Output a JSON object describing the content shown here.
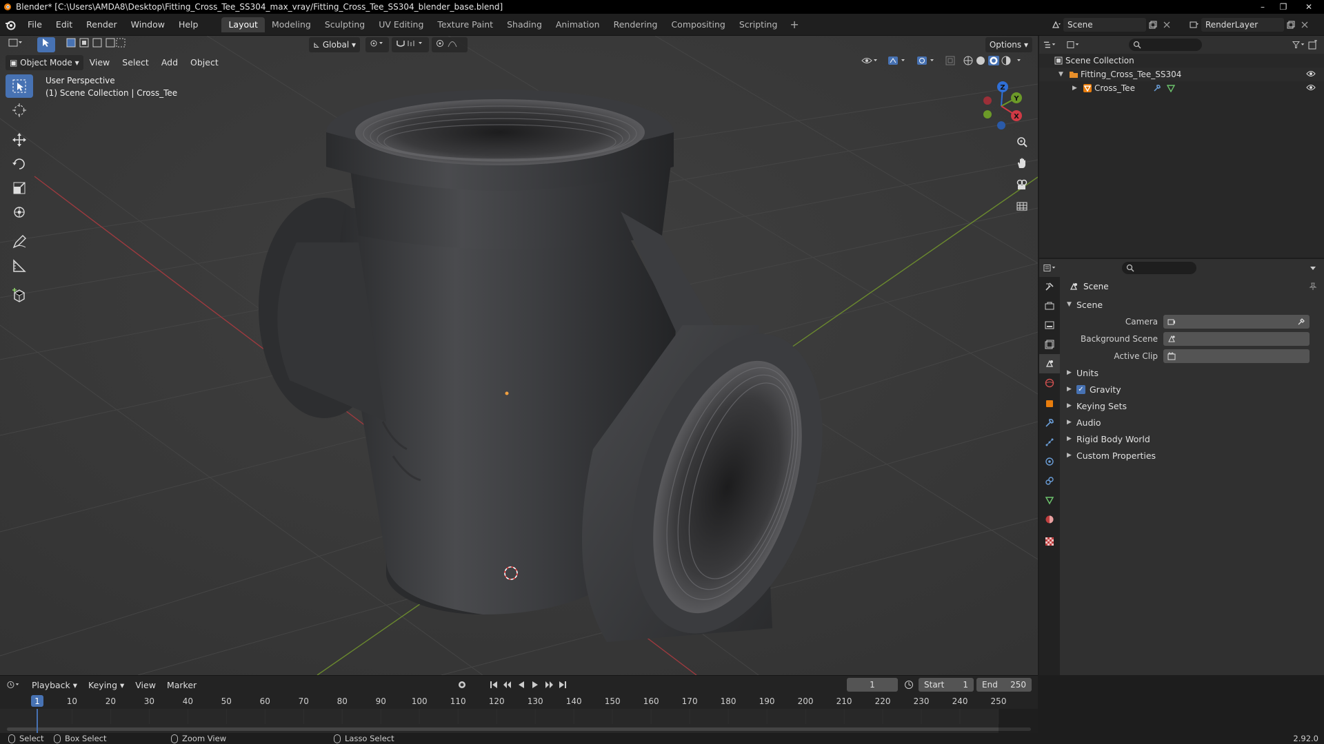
{
  "window": {
    "title": "Blender* [C:\\Users\\AMDA8\\Desktop\\Fitting_Cross_Tee_SS304_max_vray/Fitting_Cross_Tee_SS304_blender_base.blend]",
    "controls": [
      "–",
      "❐",
      "✕"
    ]
  },
  "menubar": {
    "menus": [
      "File",
      "Edit",
      "Render",
      "Window",
      "Help"
    ],
    "workspaces": [
      "Layout",
      "Modeling",
      "Sculpting",
      "UV Editing",
      "Texture Paint",
      "Shading",
      "Animation",
      "Rendering",
      "Compositing",
      "Scripting"
    ],
    "active_workspace": "Layout",
    "add_symbol": "+",
    "scene": "Scene",
    "view_layer": "RenderLayer"
  },
  "viewport": {
    "mode": "Object Mode",
    "menus": [
      "View",
      "Select",
      "Add",
      "Object"
    ],
    "transform_orientation": "Global",
    "options": "Options",
    "perspective": "User Perspective",
    "collection_path": "(1) Scene Collection | Cross_Tee",
    "gizmo_axes": {
      "x": "X",
      "y": "Y",
      "z": "Z"
    },
    "colors": {
      "x_axis": "#9e3a3f",
      "y_axis": "#6b8a2e",
      "grid": "#434343",
      "background": "#393939",
      "selection": "#4772b3"
    }
  },
  "outliner": {
    "root": "Scene Collection",
    "items": [
      {
        "label": "Fitting_Cross_Tee_SS304",
        "icon": "collection-icon"
      },
      {
        "label": "Cross_Tee",
        "icon": "mesh-object-icon"
      }
    ]
  },
  "properties": {
    "context": "Scene",
    "panel": "Scene",
    "fields": [
      {
        "label": "Camera",
        "value": ""
      },
      {
        "label": "Background Scene",
        "value": ""
      },
      {
        "label": "Active Clip",
        "value": ""
      }
    ],
    "subpanels": [
      {
        "label": "Units",
        "checkbox": false
      },
      {
        "label": "Gravity",
        "checkbox": true
      },
      {
        "label": "Keying Sets",
        "checkbox": false
      },
      {
        "label": "Audio",
        "checkbox": false
      },
      {
        "label": "Rigid Body World",
        "checkbox": false
      },
      {
        "label": "Custom Properties",
        "checkbox": false
      }
    ]
  },
  "timeline": {
    "menus": [
      "Playback",
      "Keying",
      "View",
      "Marker"
    ],
    "current_frame": "1",
    "start_label": "Start",
    "start": "1",
    "end_label": "End",
    "end": "250",
    "ticks": [
      "1",
      "10",
      "20",
      "30",
      "40",
      "50",
      "60",
      "70",
      "80",
      "90",
      "100",
      "110",
      "120",
      "130",
      "140",
      "150",
      "160",
      "170",
      "180",
      "190",
      "200",
      "210",
      "220",
      "230",
      "240",
      "250"
    ]
  },
  "statusbar": {
    "items": [
      "Select",
      "Box Select",
      "Zoom View",
      "Lasso Select"
    ],
    "version": "2.92.0"
  }
}
